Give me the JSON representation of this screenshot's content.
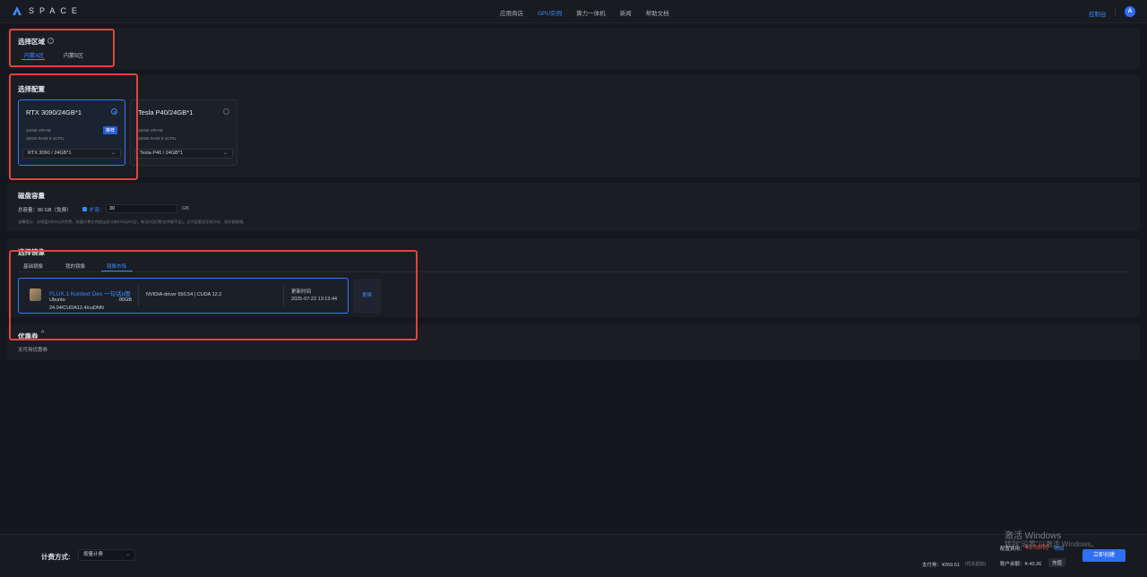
{
  "header": {
    "brand": "SPACE",
    "nav": [
      "应用商店",
      "GPU实例",
      "算力一体机",
      "新闻",
      "帮助文档"
    ],
    "active_nav_index": 1,
    "console": "控制台",
    "avatar_letter": "A"
  },
  "region": {
    "title": "选择区域",
    "tabs": [
      "内蒙A区",
      "内蒙B区"
    ],
    "active_index": 0
  },
  "config": {
    "title": "选择配置",
    "cards": [
      {
        "name": "RTX 3090/24GB*1",
        "vram": "24GB VRAM",
        "ram_cpu": "48GB RAM 8 vCPU",
        "badge": "推荐",
        "select_value": "RTX 3090 / 24GB*1",
        "selected": true
      },
      {
        "name": "Tesla P40/24GB*1",
        "vram": "24GB VRAM",
        "ram_cpu": "24GB RAM 8 vCPU",
        "badge": "",
        "select_value": "Tesla P40 / 24GB*1",
        "selected": false
      }
    ]
  },
  "disk": {
    "title": "磁盘容量",
    "total": "总容量：80 GB（免费）",
    "expand_label": "扩容：",
    "expand_value": "30",
    "unit": "GB",
    "note": "温馨提示：存储盘100G以内免费，按量计费实例超出部分按0.01元/G/日。每日0点扣费(若余额不足)。过大容量会导致开机、保存镜像慢。"
  },
  "image": {
    "title": "选择镜像",
    "tabs": [
      "基础镜像",
      "我的镜像",
      "镜像市场"
    ],
    "active_index": 2,
    "selected": {
      "name": "FLUX.1 Kontext Dev 一句话p图",
      "os": "Ubuntu",
      "version": "24.04/CUDA12.4/cuDNN",
      "size": "80GB",
      "driver": "NVIDIA-driver 550.54 | CUDA 12.2",
      "updated_label": "更新时间",
      "updated_time": "2025-07-22 13:13:44"
    },
    "change_label": "更换"
  },
  "coupon": {
    "title": "优惠券",
    "empty": "无可用优惠券"
  },
  "footer": {
    "billing_label": "计费方式:",
    "billing_value": "按量计费",
    "config_fee_label": "配置费用：",
    "config_fee_value": "¥1.58/时",
    "config_fee_detail": "明细",
    "pay_label": "支付券：¥269.51",
    "pay_note": "(优先抵扣)",
    "balance": "账户余额：¥-40.36",
    "recharge": "充值",
    "create": "立即创建"
  },
  "watermark": {
    "line1": "激活 Windows",
    "line2": "转到\"设置\"以激活 Windows。"
  },
  "colors": {
    "accent": "#3a8dff",
    "highlight": "#e0443d",
    "background": "#14171d"
  }
}
